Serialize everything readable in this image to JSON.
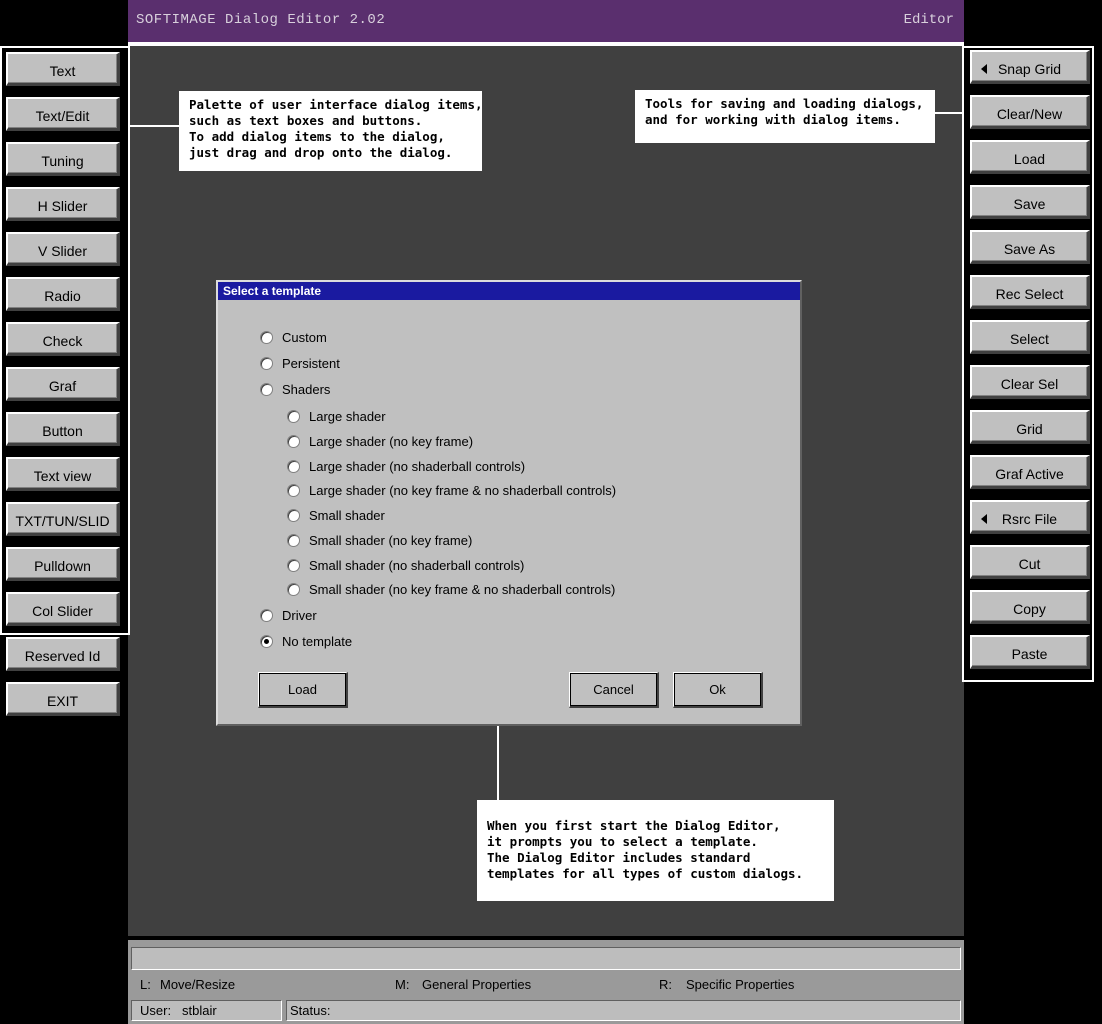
{
  "window": {
    "title": "SOFTIMAGE Dialog Editor   2.02",
    "mode": "Editor"
  },
  "palette": [
    {
      "label": "Text"
    },
    {
      "label": "Text/Edit"
    },
    {
      "label": "Tuning"
    },
    {
      "label": "H Slider"
    },
    {
      "label": "V Slider"
    },
    {
      "label": "Radio"
    },
    {
      "label": "Check"
    },
    {
      "label": "Graf"
    },
    {
      "label": "Button"
    },
    {
      "label": "Text view"
    },
    {
      "label": "TXT/TUN/SLID"
    },
    {
      "label": "Pulldown"
    },
    {
      "label": "Col Slider"
    }
  ],
  "extra_left": [
    {
      "label": "Reserved Id"
    },
    {
      "label": "EXIT"
    }
  ],
  "tools": [
    {
      "label": "Snap Grid"
    },
    {
      "label": "Clear/New"
    },
    {
      "label": "Load"
    },
    {
      "label": "Save"
    },
    {
      "label": "Save As"
    },
    {
      "label": "Rec Select"
    },
    {
      "label": "Select"
    },
    {
      "label": "Clear Sel"
    },
    {
      "label": "Grid"
    },
    {
      "label": "Graf Active"
    },
    {
      "label": "Rsrc File"
    },
    {
      "label": "Cut"
    },
    {
      "label": "Copy"
    },
    {
      "label": "Paste"
    }
  ],
  "callouts": {
    "palette": "Palette of user interface dialog items,\nsuch as text boxes and buttons.\nTo add dialog items to the dialog,\njust drag and drop onto the dialog.",
    "tools": "Tools for saving and loading dialogs,\nand for working with dialog items.",
    "template": "When you first start the Dialog Editor,\nit prompts you to select a template.\nThe Dialog Editor includes standard\ntemplates for all types of custom dialogs."
  },
  "dialog": {
    "title": "Select a template",
    "options": [
      {
        "label": "Custom",
        "selected": false
      },
      {
        "label": "Persistent",
        "selected": false
      },
      {
        "label": "Shaders",
        "selected": false
      },
      {
        "label": "Large shader",
        "selected": false
      },
      {
        "label": "Large shader (no key frame)",
        "selected": false
      },
      {
        "label": "Large shader (no shaderball controls)",
        "selected": false
      },
      {
        "label": "Large shader (no key frame & no shaderball controls)",
        "selected": false
      },
      {
        "label": "Small shader",
        "selected": false
      },
      {
        "label": "Small shader (no key frame)",
        "selected": false
      },
      {
        "label": "Small shader (no shaderball controls)",
        "selected": false
      },
      {
        "label": "Small shader (no key frame & no shaderball controls)",
        "selected": false
      },
      {
        "label": "Driver",
        "selected": false
      },
      {
        "label": "No template",
        "selected": true
      }
    ],
    "buttons": {
      "load": "Load",
      "cancel": "Cancel",
      "ok": "Ok"
    }
  },
  "statusbar": {
    "message": "",
    "mouse_left_key": "L:",
    "mouse_left": "Move/Resize",
    "mouse_middle_key": "M:",
    "mouse_middle": "General Properties",
    "mouse_right_key": "R:",
    "mouse_right": "Specific Properties",
    "user_label": "User:",
    "user": "stblair",
    "status_label": "Status:",
    "status": ""
  },
  "colors": {
    "titlebar": "#5a2f6e",
    "workspace": "#404040",
    "dialog_title": "#1a1aa0",
    "button": "#c0c0c0"
  }
}
